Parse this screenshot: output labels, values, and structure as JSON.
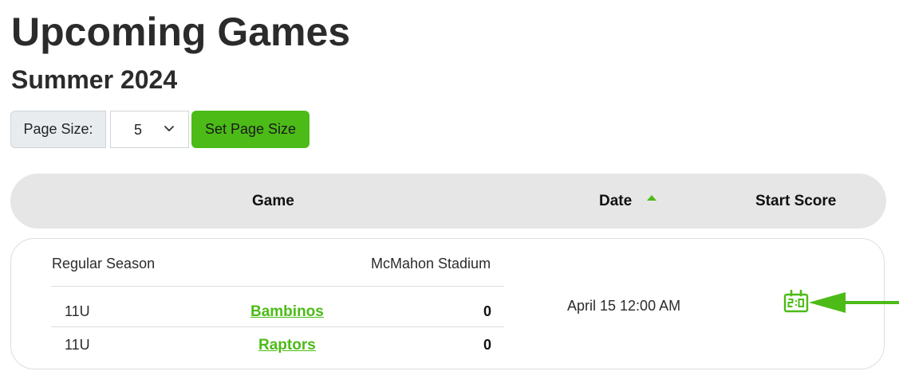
{
  "page": {
    "title": "Upcoming Games",
    "subtitle": "Summer 2024"
  },
  "page_size": {
    "label": "Page Size:",
    "selected": "5",
    "button_label": "Set Page Size"
  },
  "table": {
    "headers": {
      "game": "Game",
      "date": "Date",
      "start_score": "Start Score"
    },
    "sort": {
      "column": "date",
      "direction": "ascending"
    },
    "games": [
      {
        "season_type": "Regular Season",
        "venue": "McMahon Stadium",
        "teams": [
          {
            "division": "11U",
            "name": "Bambinos",
            "score": "0"
          },
          {
            "division": "11U",
            "name": "Raptors",
            "score": "0"
          }
        ],
        "date": "April 15 12:00 AM",
        "start_score_icon": "scoreboard-icon"
      }
    ]
  },
  "colors": {
    "accent": "#4cbb17",
    "header_bg": "#e6e6e6",
    "label_bg": "#e9ecef"
  }
}
